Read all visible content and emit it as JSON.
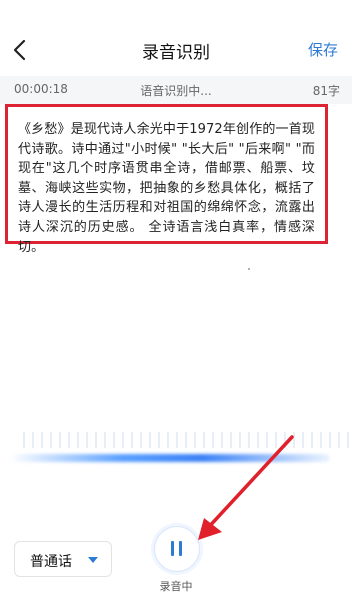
{
  "header": {
    "back_icon": "chevron-left-icon",
    "title": "录音识别",
    "save_label": "保存"
  },
  "status": {
    "time": "00:00:18",
    "state": "语音识别中...",
    "char_count": "81字"
  },
  "transcript": {
    "text": "《乡愁》是现代诗人余光中于1972年创作的一首现代诗歌。诗中通过\"小时候\" \"长大后\" \"后来啊\" \"而现在\"这几个时序语贯串全诗，借邮票、船票、坟墓、海峡这些实物，把抽象的乡愁具体化，概括了诗人漫长的生活历程和对祖国的绵绵怀念，流露出诗人深沉的历史感。 全诗语言浅白真率，情感深切。"
  },
  "dialect": {
    "selected": "普通话",
    "icon": "caret-down-icon"
  },
  "record": {
    "icon": "pause-icon",
    "label": "录音中"
  },
  "colors": {
    "accent": "#2e7bd6",
    "highlight_border": "#dd2233",
    "arrow": "#e0202a"
  }
}
